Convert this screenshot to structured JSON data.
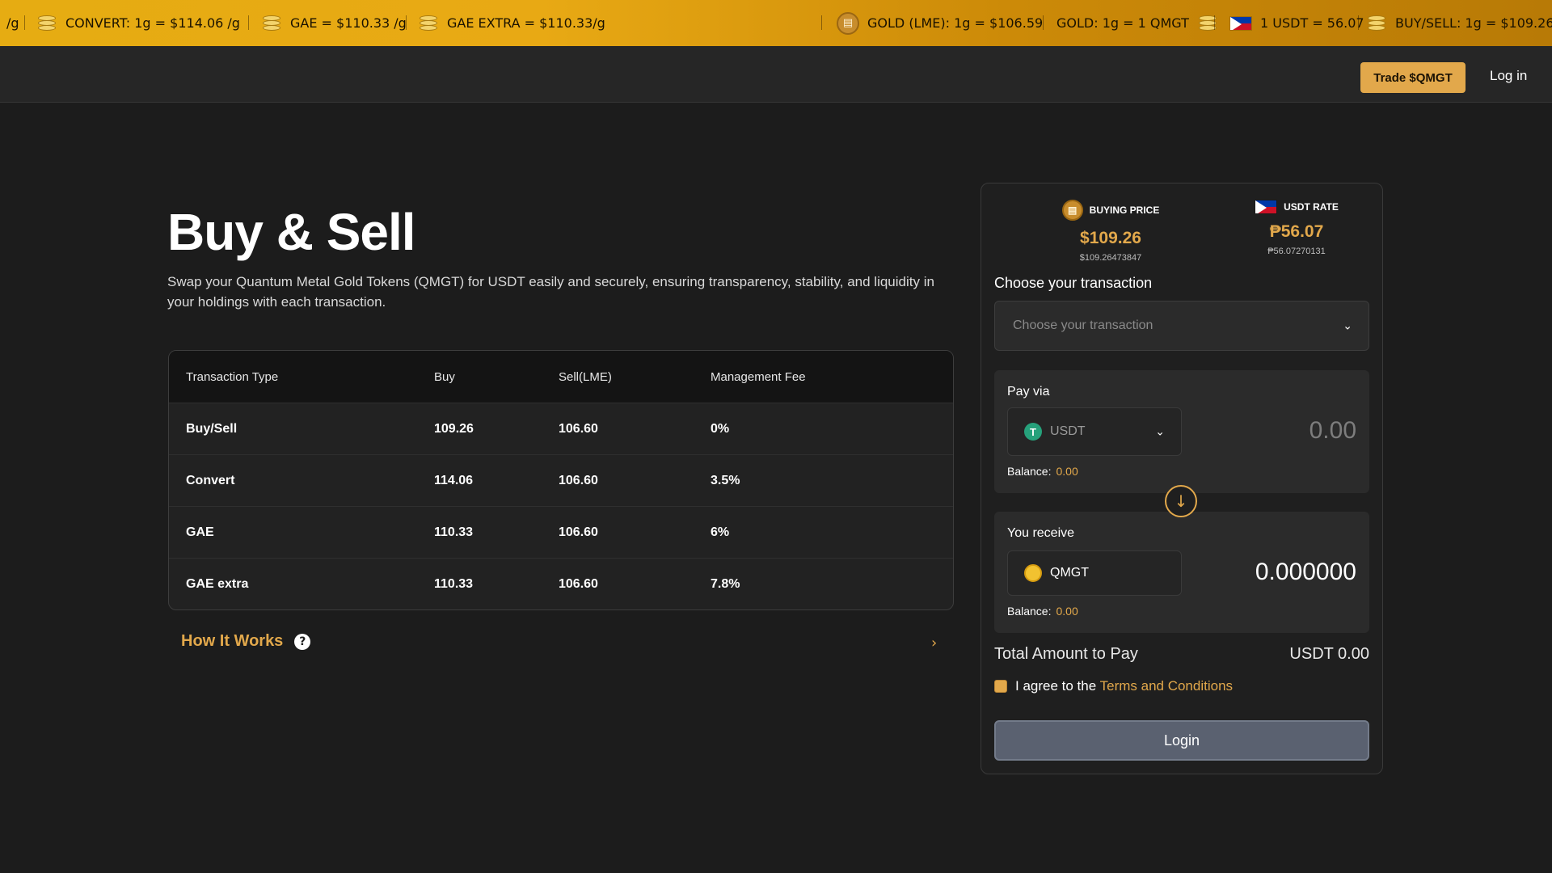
{
  "ticker": {
    "items": [
      {
        "text": "/g"
      },
      {
        "text": "CONVERT: 1g = $114.06 /g"
      },
      {
        "text": "GAE = $110.33 /g"
      },
      {
        "text": "GAE EXTRA = $110.33/g"
      },
      {
        "text": "GOLD (LME): 1g = $106.59"
      },
      {
        "text": "GOLD: 1g = 1 QMGT"
      },
      {
        "text": "1 USDT = 56.07"
      },
      {
        "text": "BUY/SELL: 1g = $109.26"
      }
    ]
  },
  "nav": {
    "trade_label": "Trade $QMGT",
    "login_label": "Log in"
  },
  "hero": {
    "title": "Buy & Sell",
    "description": "Swap your Quantum Metal Gold Tokens (QMGT) for USDT easily and securely, ensuring transparency, stability, and liquidity in your holdings with each transaction."
  },
  "table": {
    "headers": [
      "Transaction Type",
      "Buy",
      "Sell(LME)",
      "Management Fee"
    ],
    "rows": [
      [
        "Buy/Sell",
        "109.26",
        "106.60",
        "0%"
      ],
      [
        "Convert",
        "114.06",
        "106.60",
        "3.5%"
      ],
      [
        "GAE",
        "110.33",
        "106.60",
        "6%"
      ],
      [
        "GAE extra",
        "110.33",
        "106.60",
        "7.8%"
      ]
    ]
  },
  "how_it_works": {
    "label": "How It Works"
  },
  "panel": {
    "buying_price": {
      "label": "BUYING PRICE",
      "value": "$109.26",
      "precise": "$109.26473847"
    },
    "usdt_rate": {
      "label": "USDT RATE",
      "value": "₱56.07",
      "precise": "₱56.07270131"
    },
    "choose_label": "Choose your transaction",
    "choose_placeholder": "Choose your transaction",
    "pay": {
      "label": "Pay via",
      "token": "USDT",
      "amount": "0.00",
      "balance_label": "Balance:",
      "balance_value": "0.00"
    },
    "receive": {
      "label": "You receive",
      "token": "QMGT",
      "amount": "0.000000",
      "balance_label": "Balance:",
      "balance_value": "0.00"
    },
    "total_label": "Total Amount to Pay",
    "total_value": "USDT 0.00",
    "agree_text": "I agree to the",
    "terms_text": "Terms and Conditions",
    "submit_label": "Login"
  },
  "colors": {
    "accent": "#e2a84b",
    "background": "#1c1c1c",
    "ticker": "#e6ac12"
  }
}
